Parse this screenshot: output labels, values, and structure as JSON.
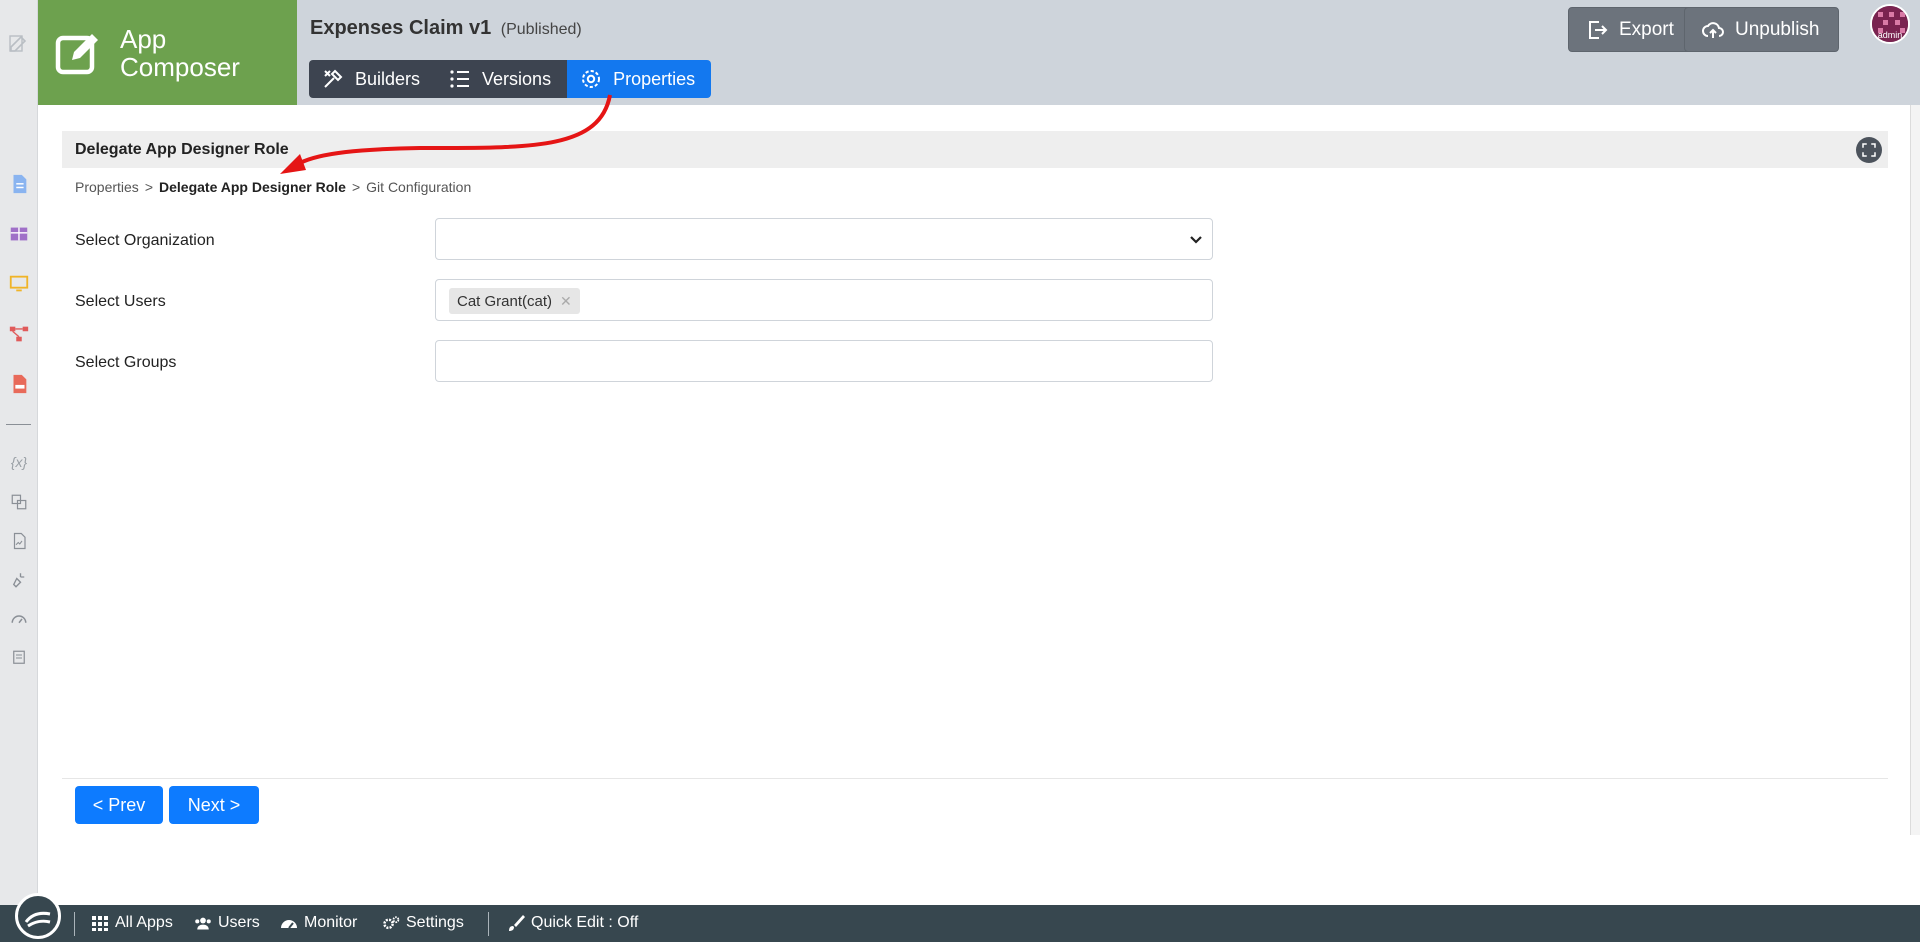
{
  "header": {
    "brand_name": "App Composer",
    "app_title": "Expenses Claim v1",
    "app_status": "(Published)",
    "tabs": [
      {
        "label": "Builders",
        "icon": "tools-icon"
      },
      {
        "label": "Versions",
        "icon": "list-icon"
      },
      {
        "label": "Properties",
        "icon": "gear-icon",
        "active": true
      }
    ],
    "export_label": "Export",
    "unpublish_label": "Unpublish",
    "avatar_label": "admin"
  },
  "panel": {
    "title": "Delegate App Designer Role",
    "breadcrumb": [
      "Properties",
      "Delegate App Designer Role",
      "Git Configuration"
    ],
    "separator": ">"
  },
  "form": {
    "organization_label": "Select Organization",
    "organization_value": "",
    "users_label": "Select Users",
    "users_selected": [
      "Cat Grant(cat)"
    ],
    "groups_label": "Select Groups",
    "groups_value": ""
  },
  "nav": {
    "prev_label": "< Prev",
    "next_label": "Next >"
  },
  "bottombar": {
    "all_apps": "All Apps",
    "users": "Users",
    "monitor": "Monitor",
    "settings": "Settings",
    "quick_edit": "Quick Edit : Off"
  },
  "colors": {
    "brand_green": "#6da14e",
    "active_tab": "#1378ef",
    "primary_button": "#0d7bff",
    "bottom_bar": "#37474f",
    "annotation_arrow": "#e51515"
  }
}
